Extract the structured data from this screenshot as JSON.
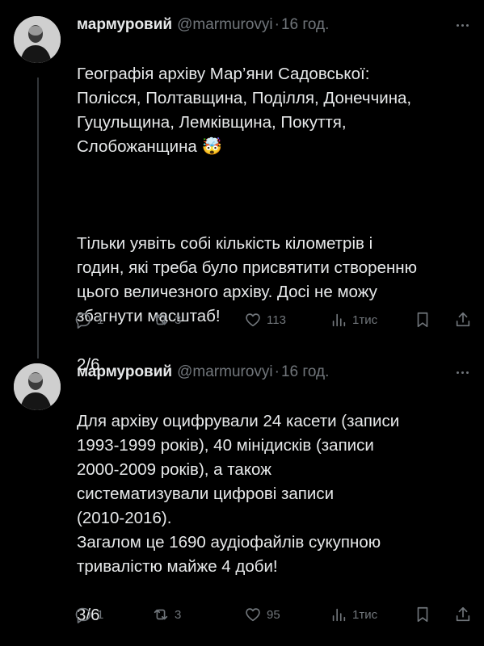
{
  "tweets": [
    {
      "author": {
        "name": "мармуровий",
        "handle": "@marmurovyi",
        "separator": "·",
        "time": "16 год."
      },
      "paragraphs": [
        "Географія архіву Мар’яни Садовської:\nПолісся, Полтавщина, Поділля, Донеччина,\nГуцульщина, Лемківщина, Покуття,\nСлобожанщина 🤯",
        "Тільки уявіть собі кількість кілометрів і\nгодин, які треба було присвятити створенню\nцього величезного архіву. Досі не можу\nзбагнути масштаб!"
      ],
      "counter": "2/6",
      "stats": {
        "replies": "1",
        "reposts": "3",
        "likes": "113",
        "views": "1тис"
      }
    },
    {
      "author": {
        "name": "мармуровий",
        "handle": "@marmurovyi",
        "separator": "·",
        "time": "16 год."
      },
      "paragraphs": [
        "Для архіву оцифрували 24 касети (записи\n1993-1999 років), 40 мінідисків (записи\n2000-2009 років), а також\nсистематизували цифрові записи\n(2010-2016).\nЗагалом це 1690 аудіофайлів сукупною\nтривалістю майже 4 доби!"
      ],
      "counter": "3/6",
      "stats": {
        "replies": "1",
        "reposts": "3",
        "likes": "95",
        "views": "1тис"
      }
    }
  ],
  "icons": {
    "reply": "reply-icon",
    "repost": "repost-icon",
    "like": "heart-icon",
    "views": "views-icon",
    "bookmark": "bookmark-icon",
    "share": "share-icon",
    "more": "more-icon"
  },
  "colors": {
    "background": "#000000",
    "text": "#e7e9ea",
    "muted": "#71767b",
    "divider": "#333639"
  }
}
